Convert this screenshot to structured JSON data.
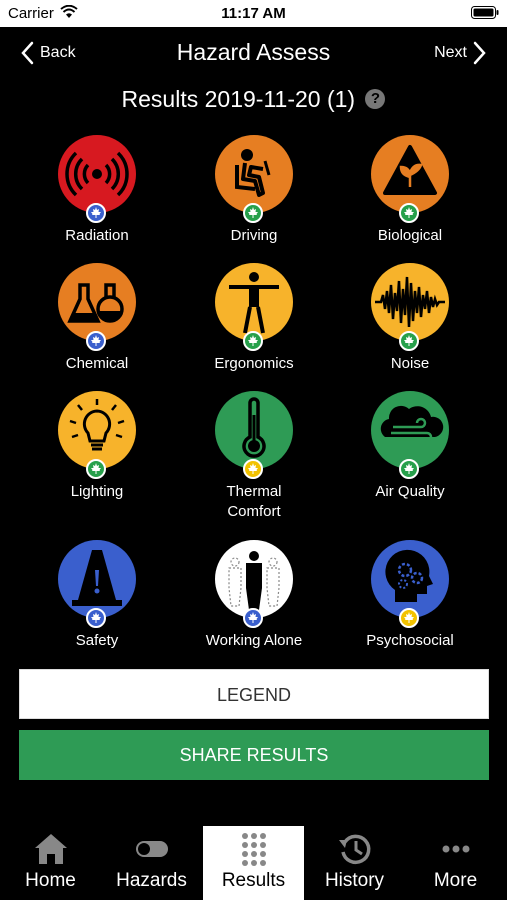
{
  "status_bar": {
    "carrier": "Carrier",
    "time": "11:17 AM"
  },
  "nav": {
    "back_label": "Back",
    "title": "Hazard Assess",
    "next_label": "Next"
  },
  "results_title": "Results 2019-11-20 (1)",
  "help_icon": "?",
  "hazards": [
    {
      "label": "Radiation",
      "icon": "radiation-icon",
      "color": "#d71920",
      "badge_color": "#3a5fcd"
    },
    {
      "label": "Driving",
      "icon": "driving-icon",
      "color": "#e67e22",
      "badge_color": "#27a04b"
    },
    {
      "label": "Biological",
      "icon": "biological-icon",
      "color": "#e67e22",
      "badge_color": "#27a04b"
    },
    {
      "label": "Chemical",
      "icon": "chemical-icon",
      "color": "#e67e22",
      "badge_color": "#3a5fcd"
    },
    {
      "label": "Ergonomics",
      "icon": "ergonomics-icon",
      "color": "#f7b32b",
      "badge_color": "#27a04b"
    },
    {
      "label": "Noise",
      "icon": "noise-icon",
      "color": "#f7b32b",
      "badge_color": "#27a04b"
    },
    {
      "label": "Lighting",
      "icon": "lighting-icon",
      "color": "#f7b32b",
      "badge_color": "#27a04b"
    },
    {
      "label": "Thermal\nComfort",
      "icon": "thermometer-icon",
      "color": "#2e9b55",
      "badge_color": "#f2c200"
    },
    {
      "label": "Air Quality",
      "icon": "air-quality-icon",
      "color": "#2e9b55",
      "badge_color": "#27a04b"
    },
    {
      "label": "Safety",
      "icon": "safety-cone-icon",
      "color": "#3a5fcd",
      "badge_color": "#3a5fcd"
    },
    {
      "label": "Working Alone",
      "icon": "working-alone-icon",
      "color": "#ffffff",
      "badge_color": "#3a5fcd"
    },
    {
      "label": "Psychosocial",
      "icon": "psychosocial-icon",
      "color": "#3a5fcd",
      "badge_color": "#f2c200"
    }
  ],
  "buttons": {
    "legend": "LEGEND",
    "share": "SHARE RESULTS"
  },
  "tabs": [
    {
      "label": "Home",
      "icon": "home-icon",
      "active": false
    },
    {
      "label": "Hazards",
      "icon": "toggle-icon",
      "active": false
    },
    {
      "label": "Results",
      "icon": "grid-dots-icon",
      "active": true
    },
    {
      "label": "History",
      "icon": "history-icon",
      "active": false
    },
    {
      "label": "More",
      "icon": "more-dots-icon",
      "active": false
    }
  ]
}
